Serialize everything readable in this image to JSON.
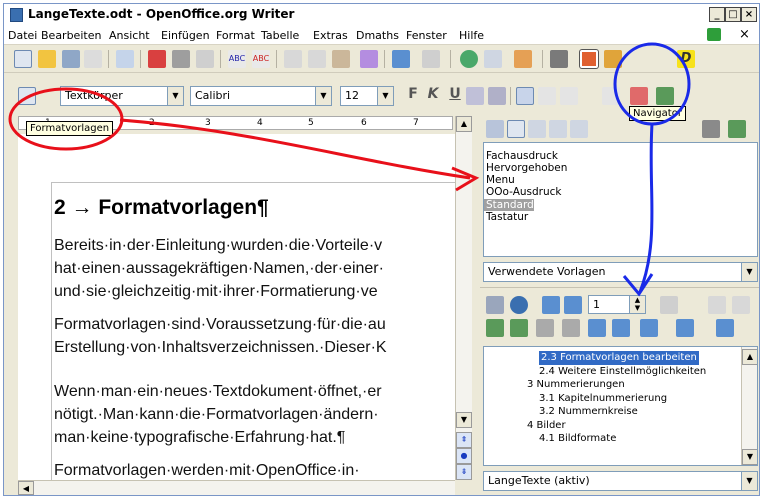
{
  "window": {
    "title": "LangeTexte.odt - OpenOffice.org Writer"
  },
  "menu": [
    "Datei",
    "Bearbeiten",
    "Ansicht",
    "Einfügen",
    "Format",
    "Tabelle",
    "Extras",
    "Dmaths",
    "Fenster",
    "Hilfe"
  ],
  "formatting": {
    "style": "Textkörper",
    "font": "Calibri",
    "size": "12",
    "bold": "F",
    "italic": "K",
    "underline": "U"
  },
  "tooltips": {
    "styles": "Formatvorlagen",
    "navigator": "Navigator"
  },
  "ruler": [
    "1",
    "2",
    "3",
    "4",
    "5",
    "6",
    "7"
  ],
  "document": {
    "heading": "2 → Formatvorlagen¶",
    "paragraphs": [
      "Bereits·in·der·Einleitung·wurden·die·Vorteile·v",
      "hat·einen·aussagekräftigen·Namen,·der·einer·",
      "und·sie·gleichzeitig·mit·ihrer·Formatierung·ve",
      "Formatvorlagen·sind·Voraussetzung·für·die·au",
      "Erstellung·von·Inhaltsverzeichnissen.·Dieser·K",
      "Wenn·man·ein·neues·Textdokument·öffnet,·er",
      "nötigt.·Man·kann·die·Formatvorlagen·ändern·",
      "man·keine·typografische·Erfahrung·hat.¶",
      "Formatvorlagen·werden·mit·OpenOffice·in·"
    ]
  },
  "stylist": {
    "styles": [
      "Fachausdruck",
      "Hervorgehoben",
      "Menu",
      "OOo-Ausdruck",
      "Standard",
      "Tastatur"
    ],
    "selected": "Standard",
    "filter": "Verwendete Vorlagen"
  },
  "navigator": {
    "page": "1",
    "items": [
      {
        "text": "2.3 Formatvorlagen bearbeiten",
        "level": 3,
        "selected": true
      },
      {
        "text": "2.4 Weitere Einstellmöglichkeiten",
        "level": 3
      },
      {
        "text": "3 Nummerierungen",
        "level": 2
      },
      {
        "text": "3.1 Kapitelnummerierung",
        "level": 3
      },
      {
        "text": "3.2 Nummernkreise",
        "level": 3
      },
      {
        "text": "4 Bilder",
        "level": 2
      },
      {
        "text": "4.1 Bildformate",
        "level": 3
      }
    ],
    "document": "LangeTexte (aktiv)"
  },
  "colors": {
    "annotation_red": "#e8101a",
    "annotation_blue": "#1a2ae8",
    "selection": "#316ac5"
  }
}
